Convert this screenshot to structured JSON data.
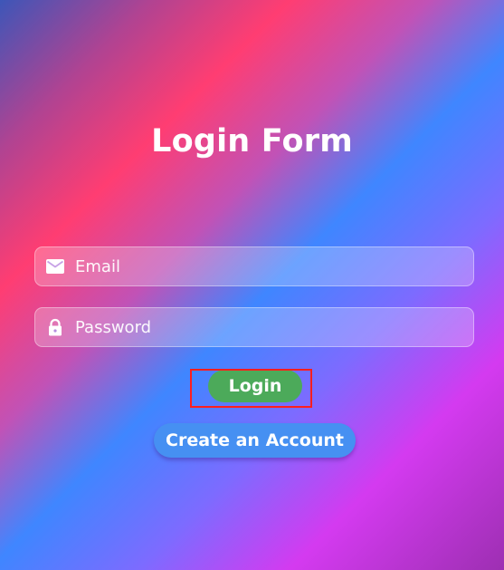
{
  "form": {
    "title": "Login Form",
    "email": {
      "placeholder": "Email",
      "value": "",
      "icon": "envelope-icon"
    },
    "password": {
      "placeholder": "Password",
      "value": "",
      "icon": "lock-icon"
    },
    "login_label": "Login",
    "create_account_label": "Create an Account"
  },
  "colors": {
    "login_button": "#4caa5a",
    "create_account_button": "#4690f2",
    "highlight_border": "#ff1e1e",
    "text": "#ffffff"
  }
}
